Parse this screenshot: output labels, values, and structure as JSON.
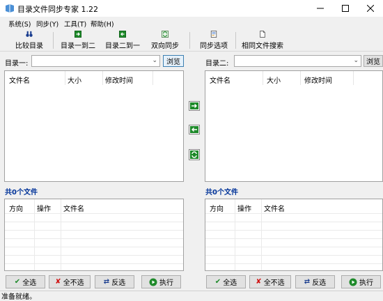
{
  "window": {
    "title": "目录文件同步专家 1.22"
  },
  "menu": [
    "系统(S)",
    "同步(Y)",
    "工具(T)",
    "帮助(H)"
  ],
  "toolbar": {
    "compare": "比较目录",
    "one_to_two": "目录一到二",
    "two_to_one": "目录二到一",
    "bidirectional": "双向同步",
    "sync_options": "同步选项",
    "same_file_search": "相同文件搜索"
  },
  "left": {
    "dir_label": "目录一:",
    "dir_value": "",
    "browse": "浏览",
    "columns": [
      "文件名",
      "大小",
      "修改时间"
    ],
    "count": "共0个文件",
    "ops_columns": [
      "方向",
      "操作",
      "文件名"
    ],
    "buttons": {
      "select_all": "全选",
      "select_none": "全不选",
      "invert": "反选",
      "execute": "执行"
    }
  },
  "right": {
    "dir_label": "目录二:",
    "dir_value": "",
    "browse": "浏览",
    "columns": [
      "文件名",
      "大小",
      "修改时间"
    ],
    "count": "共0个文件",
    "ops_columns": [
      "方向",
      "操作",
      "文件名"
    ],
    "buttons": {
      "select_all": "全选",
      "select_none": "全不选",
      "invert": "反选",
      "execute": "执行"
    }
  },
  "status": "准备就绪。",
  "colors": {
    "accent_green": "#1e8a2a",
    "count_blue": "#003399",
    "browse_border": "#3c7fb1"
  }
}
